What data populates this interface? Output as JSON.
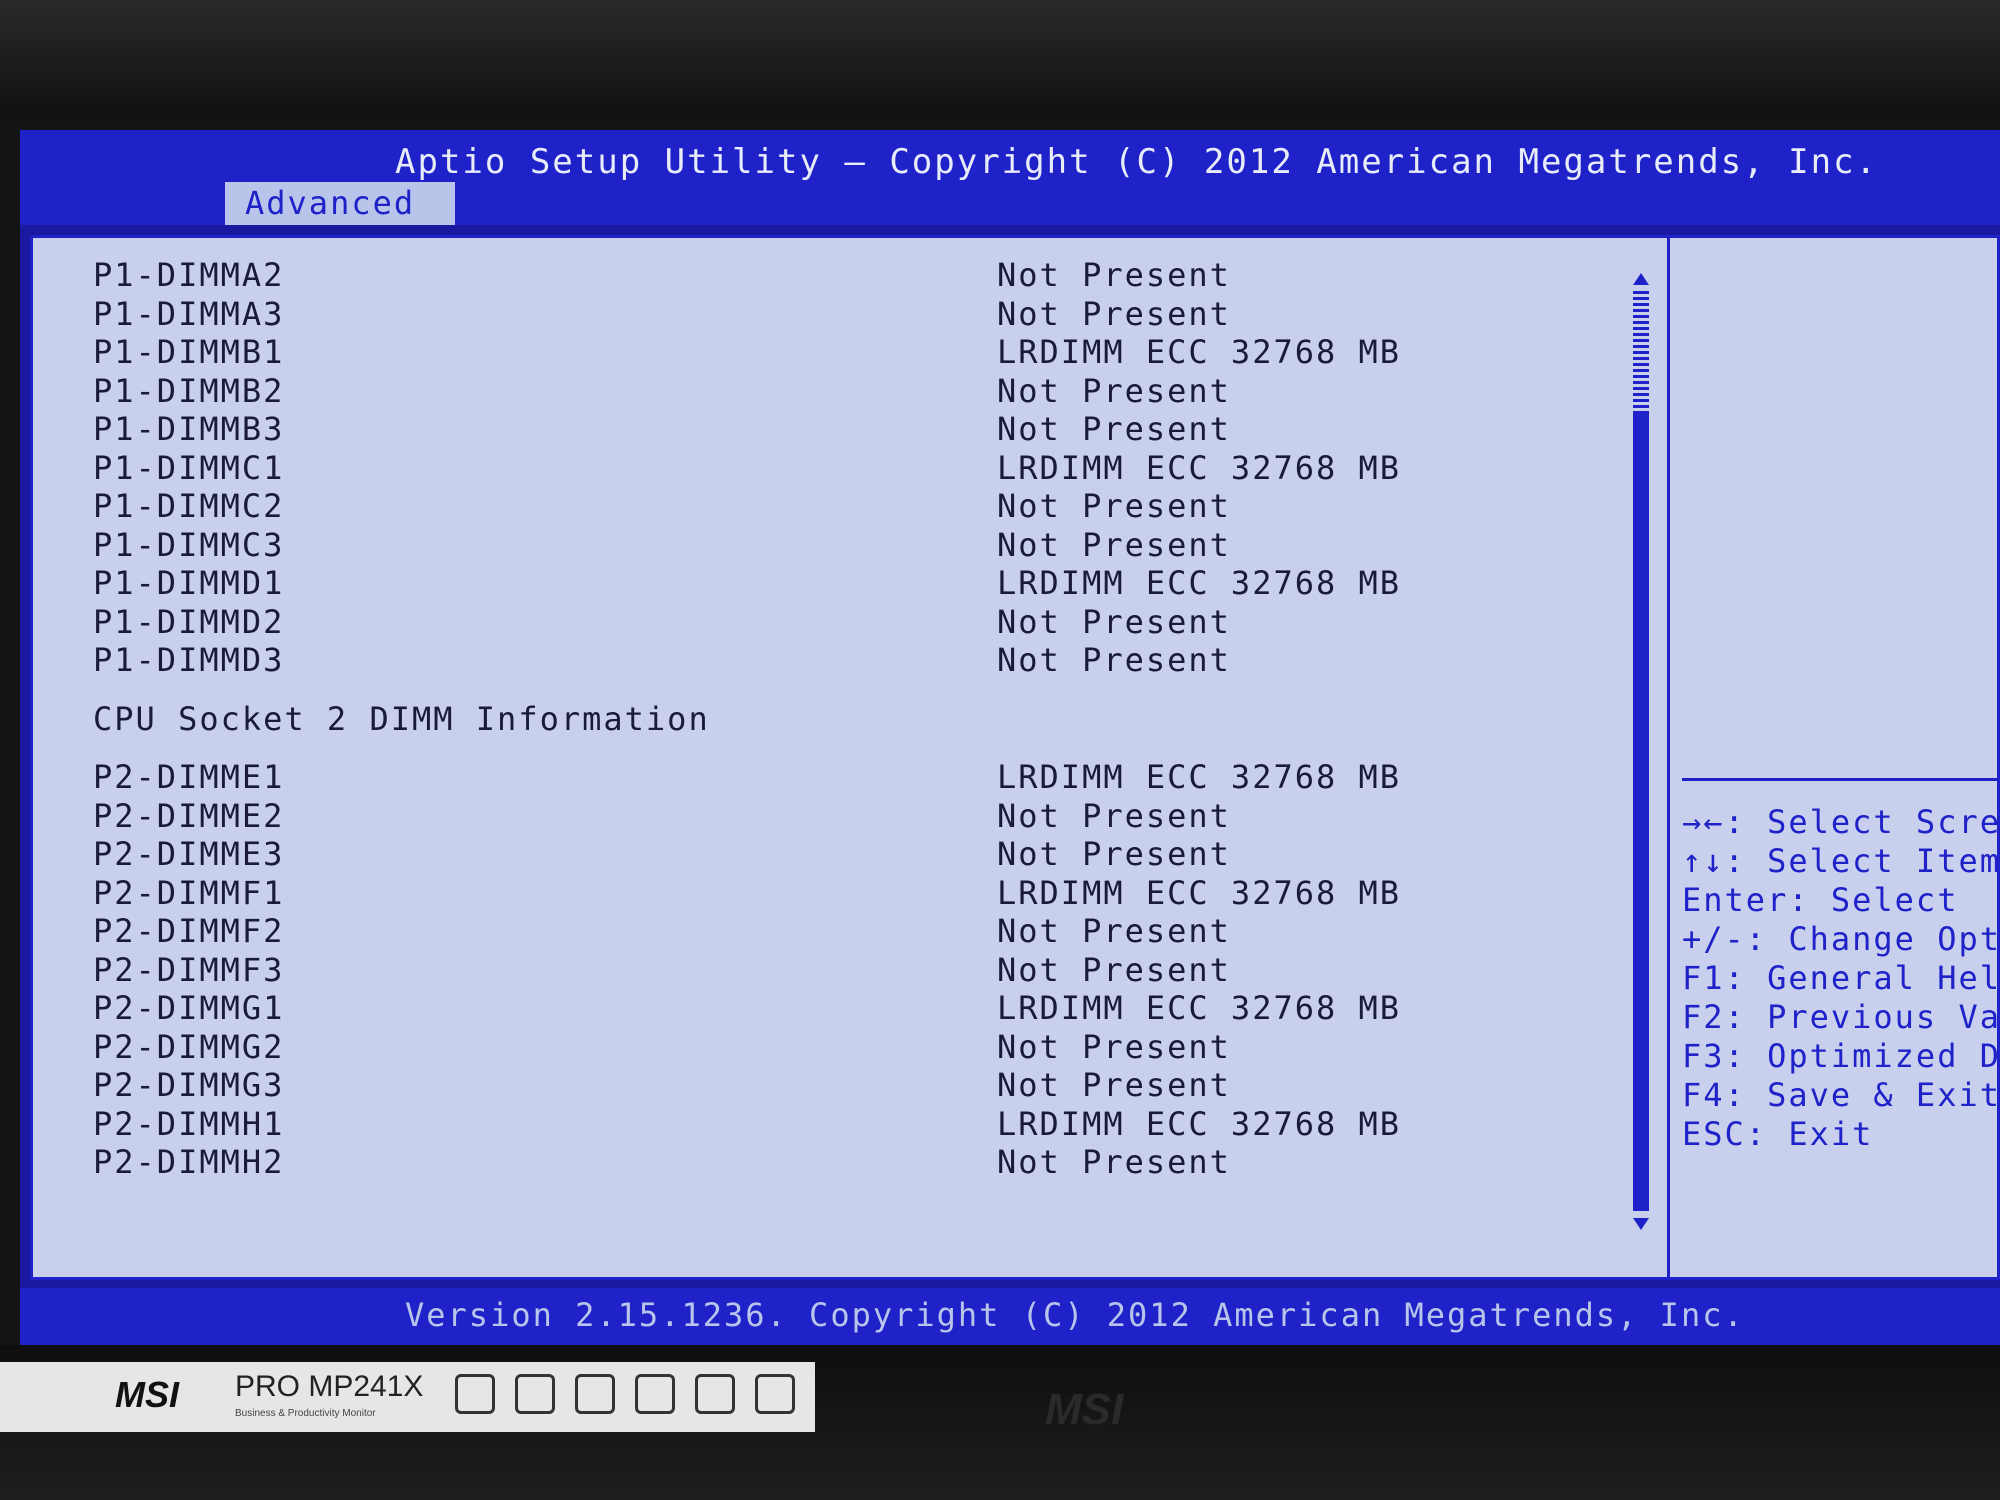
{
  "header": {
    "title": "Aptio Setup Utility – Copyright (C) 2012 American Megatrends, Inc.",
    "active_tab": "Advanced"
  },
  "dimms_p1": [
    {
      "name": "P1-DIMMA2",
      "value": "Not Present"
    },
    {
      "name": "P1-DIMMA3",
      "value": "Not Present"
    },
    {
      "name": "P1-DIMMB1",
      "value": "LRDIMM ECC 32768 MB"
    },
    {
      "name": "P1-DIMMB2",
      "value": "Not Present"
    },
    {
      "name": "P1-DIMMB3",
      "value": "Not Present"
    },
    {
      "name": "P1-DIMMC1",
      "value": "LRDIMM ECC 32768 MB"
    },
    {
      "name": "P1-DIMMC2",
      "value": "Not Present"
    },
    {
      "name": "P1-DIMMC3",
      "value": "Not Present"
    },
    {
      "name": "P1-DIMMD1",
      "value": "LRDIMM ECC 32768 MB"
    },
    {
      "name": "P1-DIMMD2",
      "value": "Not Present"
    },
    {
      "name": "P1-DIMMD3",
      "value": "Not Present"
    }
  ],
  "section_p2": "CPU Socket 2 DIMM Information",
  "dimms_p2": [
    {
      "name": "P2-DIMME1",
      "value": "LRDIMM ECC 32768 MB"
    },
    {
      "name": "P2-DIMME2",
      "value": "Not Present"
    },
    {
      "name": "P2-DIMME3",
      "value": "Not Present"
    },
    {
      "name": "P2-DIMMF1",
      "value": "LRDIMM ECC 32768 MB"
    },
    {
      "name": "P2-DIMMF2",
      "value": "Not Present"
    },
    {
      "name": "P2-DIMMF3",
      "value": "Not Present"
    },
    {
      "name": "P2-DIMMG1",
      "value": "LRDIMM ECC 32768 MB"
    },
    {
      "name": "P2-DIMMG2",
      "value": "Not Present"
    },
    {
      "name": "P2-DIMMG3",
      "value": "Not Present"
    },
    {
      "name": "P2-DIMMH1",
      "value": "LRDIMM ECC 32768 MB"
    },
    {
      "name": "P2-DIMMH2",
      "value": "Not Present"
    }
  ],
  "help": [
    "→←: Select Scre",
    "↑↓: Select Item",
    "Enter: Select",
    "+/-: Change Opt",
    "F1: General Hel",
    "F2: Previous Va",
    "F3: Optimized D",
    "F4: Save & Exit",
    "ESC: Exit"
  ],
  "footer": {
    "text": "Version 2.15.1236. Copyright (C) 2012 American Megatrends, Inc."
  },
  "monitor": {
    "sticker_brand": "MSI",
    "sticker_model": "PRO MP241X",
    "sticker_tagline": "Business & Productivity Monitor",
    "bezel_brand": "MSI"
  },
  "colors": {
    "title_bar": "#1e22c8",
    "panel_bg": "#c9d0ee",
    "text": "#1a1a3a",
    "help_text": "#1e22c8"
  },
  "icons": {
    "scroll_up": "triangle-up-icon",
    "scroll_down": "triangle-down-icon"
  }
}
